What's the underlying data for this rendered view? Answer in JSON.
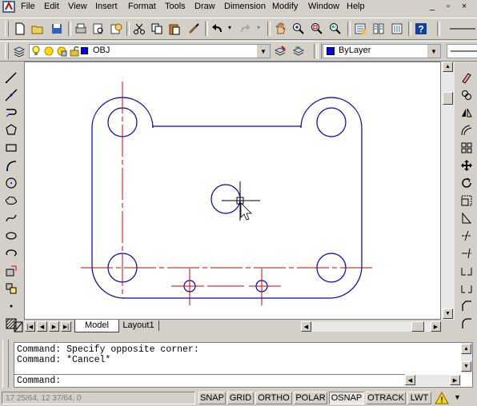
{
  "menubar": {
    "items": [
      "File",
      "Edit",
      "View",
      "Insert",
      "Format",
      "Tools",
      "Draw",
      "Dimension",
      "Modify",
      "Window",
      "Help"
    ]
  },
  "window_controls": [
    "minimize-icon",
    "restore-icon",
    "close-icon"
  ],
  "layers_toolbar": {
    "layer_name": "OBJ",
    "layer_color": "#0000ff",
    "color_control": "ByLayer",
    "color_swatch": "#0000ff"
  },
  "layout_tabs": [
    "Model",
    "Layout1"
  ],
  "command": {
    "history": [
      "Command: Specify opposite corner:",
      "Command: *Cancel*"
    ],
    "prompt": "Command:"
  },
  "status_bar": {
    "coordinates": "17 25/64, 12 37/64, 0",
    "toggles": [
      {
        "label": "SNAP",
        "on": false
      },
      {
        "label": "GRID",
        "on": false
      },
      {
        "label": "ORTHO",
        "on": false
      },
      {
        "label": "POLAR",
        "on": false
      },
      {
        "label": "OSNAP",
        "on": true
      },
      {
        "label": "OTRACK",
        "on": false
      },
      {
        "label": "LWT",
        "on": false
      }
    ]
  },
  "colors": {
    "object_lines": "#0000c0",
    "center_lines": "#d00000",
    "crosshair": "#000000"
  }
}
